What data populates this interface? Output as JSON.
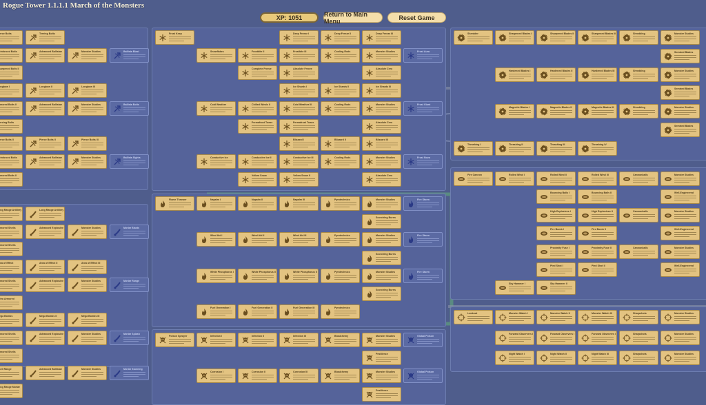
{
  "window": {
    "title": "Rogue Tower 1.1.1.1 March of the Monsters"
  },
  "header": {
    "xp_label": "XP: 1051",
    "main_menu_label": "Return to Main Menu",
    "reset_label": "Reset Game"
  },
  "colors": {
    "background": "#4f5d8c",
    "node": "#e3c381",
    "node_border": "#a88a4a",
    "panel_border": "#6d7db0",
    "modifier_node": "#5b6aa3"
  },
  "panels": {
    "ballista": {
      "icon": "arrow-icon",
      "rows": [
        [
          "Pierce Bolts",
          "Treeing Bolts",
          "",
          ""
        ],
        [
          "Reinforced Bolts",
          "Advanced Ballistae",
          "Monster Studies",
          "Ballista Blast"
        ],
        [
          "Sharpened Bolts II",
          "",
          "",
          ""
        ],
        [
          "Longbow I",
          "Longbow II",
          "Longbow III",
          ""
        ],
        [
          "Armored Bolts II",
          "Advanced Ballistae",
          "Monster Studies",
          "Ballista Bolts"
        ],
        [
          "Piercing Bolts",
          "",
          "",
          ""
        ],
        [
          "Pierce Bolts II",
          "Pierce Bolts II",
          "Pierce Bolts III",
          ""
        ],
        [
          "Reinforced Bolts",
          "Advanced Ballistae",
          "Monster Studies",
          "Ballista Sights"
        ],
        [
          "Armored Bolts II",
          "",
          "",
          ""
        ]
      ]
    },
    "mortar": {
      "icon": "mortar-icon",
      "rows": [
        [
          "Long Range Artillery",
          "Long Range Artillery II",
          "",
          ""
        ],
        [
          "Armored Shells",
          "Advanced Explosives",
          "Monster Studies",
          "Mortar Blasts"
        ],
        [
          "Armored Shells",
          "",
          "",
          ""
        ],
        [
          "Area of Effect",
          "Area of Effect II",
          "Area of Effect III",
          ""
        ],
        [
          "Armored Shells",
          "Advanced Explosives",
          "Monster Studies",
          "Mortar Range"
        ],
        [
          "Extra Armored",
          "",
          "",
          ""
        ],
        [
          "Mega Bombs",
          "Mega Bombs II",
          "Mega Bombs III",
          ""
        ],
        [
          "Armored Shells",
          "Advanced Explosives",
          "Monster Studies",
          "Mortar Splash"
        ],
        [
          "Armored Shells",
          "",
          "",
          ""
        ],
        [
          "Shell Range",
          "Advanced Ballistae",
          "Monster Studies",
          "Mortar Stunning"
        ],
        [
          "Long Range Mortar",
          "",
          "",
          ""
        ]
      ]
    },
    "frost": {
      "icon": "snowflake-icon",
      "cells": [
        [
          "Frost Keep",
          "",
          "",
          "Deep Freeze I",
          "Deep Freeze II",
          "Deep Freeze III",
          ""
        ],
        [
          "",
          "Snowflakes",
          "Frostbite II",
          "Frostbite III",
          "Cooling Rods",
          "Monster Studies",
          "Frost Aura"
        ],
        [
          "",
          "",
          "Complete Freeze",
          "Absolute Freeze",
          "",
          "Absolute Zero",
          ""
        ],
        [
          "",
          "",
          "",
          "Ice Shards I",
          "Ice Shards II",
          "Ice Shards III",
          ""
        ],
        [
          "",
          "Cold Weather",
          "Chilled Winds II",
          "Cold Weather III",
          "Cooling Rods",
          "Monster Studies",
          "Frost Giant"
        ],
        [
          "",
          "",
          "Permafrost Tower",
          "Permafrost Tower",
          "",
          "Absolute Zero",
          ""
        ],
        [
          "",
          "",
          "",
          "Blizzard I",
          "Blizzard II",
          "Blizzard III",
          ""
        ],
        [
          "",
          "Conductive Ice",
          "Conductive Ice II",
          "Conductive Ice III",
          "Cooling Rods",
          "Monster Studies",
          "Frost Nova"
        ],
        [
          "",
          "",
          "Yellow Snow",
          "Yellow Snow II",
          "",
          "Absolute Zero",
          ""
        ]
      ]
    },
    "flame": {
      "icon": "flame-icon",
      "cells": [
        [
          "Flame Thrower",
          "Napalm I",
          "Napalm II",
          "Napalm III",
          "Pyrotechnics",
          "Monster Studies",
          "Fire Storm"
        ],
        [
          "",
          "",
          "",
          "",
          "",
          "Scorching Burns",
          ""
        ],
        [
          "",
          "Wind Aid I",
          "Wind Aid II",
          "Wind Aid III",
          "Pyrotechnics",
          "Monster Studies",
          "Fire Storm"
        ],
        [
          "",
          "",
          "",
          "",
          "",
          "Scorching Burns",
          ""
        ],
        [
          "",
          "White Phosphorus I",
          "White Phosphorus II",
          "White Phosphorus III",
          "Pyrotechnics",
          "Monster Studies",
          "Fire Storm"
        ],
        [
          "",
          "",
          "",
          "",
          "",
          "Scorching Burns",
          ""
        ],
        [
          "",
          "Fuel Generation I",
          "Fuel Generation II",
          "Fuel Generation III",
          "Pyrotechnics",
          "",
          ""
        ]
      ]
    },
    "poison": {
      "icon": "skull-icon",
      "cells": [
        [
          "Poison Sprayer",
          "Infection I",
          "Infection II",
          "Infection III",
          "Bioalchemy",
          "Monster Studies",
          "Global Poison"
        ],
        [
          "",
          "",
          "",
          "",
          "",
          "Pestilence",
          ""
        ],
        [
          "",
          "Corrosion I",
          "Corrosion II",
          "Corrosion III",
          "Bioalchemy",
          "Monster Studies",
          "Global Poison"
        ],
        [
          "",
          "",
          "",
          "",
          "",
          "Pestilence",
          ""
        ]
      ]
    },
    "saw": {
      "icon": "saw-icon",
      "cells": [
        [
          "Shredder",
          "Sharpened Blades I",
          "Sharpened Blades II",
          "Sharpened Blades III",
          "Shredding",
          "Monster Studies"
        ],
        [
          "",
          "",
          "",
          "",
          "",
          "Serrated Blades"
        ],
        [
          "",
          "Hardened Blades I",
          "Hardened Blades II",
          "Hardened Blades III",
          "Shredding",
          "Monster Studies"
        ],
        [
          "",
          "",
          "",
          "",
          "",
          "Serrated Blades"
        ],
        [
          "",
          "Magnetic Blades I",
          "Magnetic Blades II",
          "Magnetic Blades III",
          "Shredding",
          "Monster Studies"
        ],
        [
          "",
          "",
          "",
          "",
          "",
          "Serrated Blades"
        ],
        [
          "Thrashing I",
          "Thrashing II",
          "Thrashing III",
          "Thrashing IV",
          "",
          ""
        ]
      ]
    },
    "cannon": {
      "icon": "cannonball-icon",
      "cells": [
        [
          "Fire Cannon",
          "Rolled Wind I",
          "Rolled Wind II",
          "Rolled Wind III",
          "Cannonballs",
          "Monster Studies"
        ],
        [
          "",
          "",
          "Bouncing Balls I",
          "Bouncing Balls II",
          "",
          "Well-Engineered"
        ],
        [
          "",
          "",
          "High Explosives I",
          "High Explosives II",
          "Cannonballs",
          "Monster Studies"
        ],
        [
          "",
          "",
          "Fire Bomb I",
          "Fire Bomb II",
          "",
          "Well-Engineered"
        ],
        [
          "",
          "",
          "Proximity Fuse I",
          "Proximity Fuse II",
          "Cannonballs",
          "Monster Studies"
        ],
        [
          "",
          "",
          "Pied Shot I",
          "Pied Shot II",
          "",
          "Well-Engineered"
        ],
        [
          "",
          "Sky Hammer I",
          "Sky Hammer II",
          "",
          "",
          ""
        ]
      ]
    },
    "sniper": {
      "icon": "crosshair-icon",
      "cells": [
        [
          "Lookout",
          "Monster Watch I",
          "Monster Watch II",
          "Monster Watch III",
          "Sharpshots",
          "Monster Studies"
        ],
        [
          "",
          "Forward Observers I",
          "Forward Observers II",
          "Forward Observers III",
          "Sharpshots",
          "Monster Studies"
        ],
        [
          "",
          "Night Watch I",
          "Night Watch II",
          "Night Watch III",
          "Sharpshots",
          "Monster Studies"
        ]
      ]
    }
  }
}
